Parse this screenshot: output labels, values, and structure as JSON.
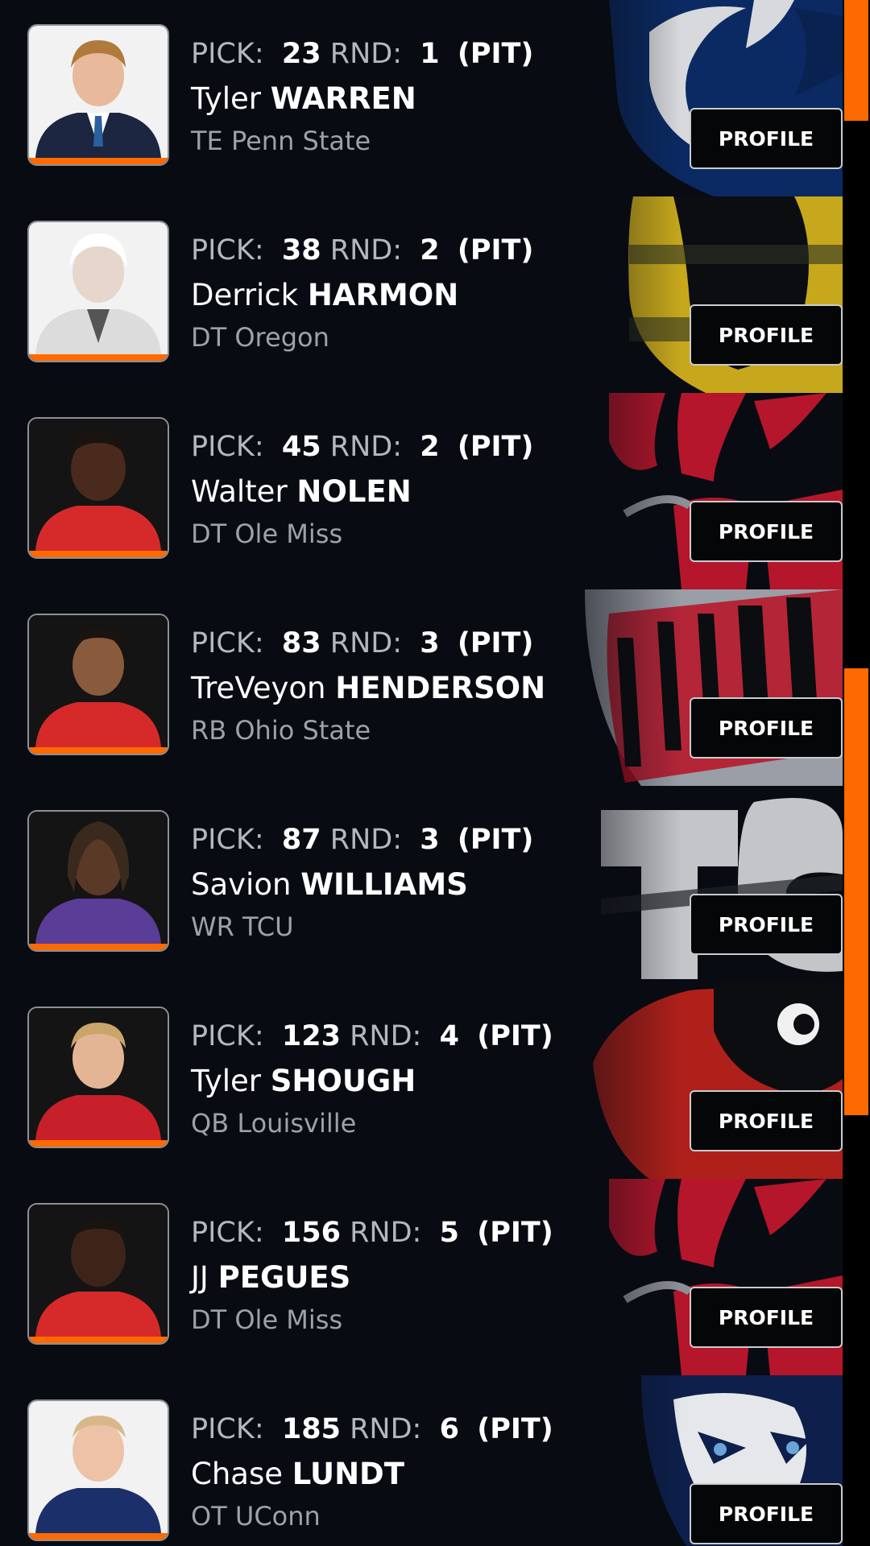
{
  "labels": {
    "pick": "PICK:",
    "round": "RND:",
    "profile": "PROFILE"
  },
  "colors": {
    "accent": "#ff6a00",
    "row_bg": "#080b12"
  },
  "picks": [
    {
      "pick": "23",
      "round": "1",
      "team": "(PIT)",
      "first": "Tyler",
      "last": "WARREN",
      "position_school": "TE Penn State",
      "logo": "penn-state-logo"
    },
    {
      "pick": "38",
      "round": "2",
      "team": "(PIT)",
      "first": "Derrick",
      "last": "HARMON",
      "position_school": "DT Oregon",
      "logo": "oregon-logo"
    },
    {
      "pick": "45",
      "round": "2",
      "team": "(PIT)",
      "first": "Walter",
      "last": "NOLEN",
      "position_school": "DT Ole Miss",
      "logo": "ole-miss-logo"
    },
    {
      "pick": "83",
      "round": "3",
      "team": "(PIT)",
      "first": "TreVeyon",
      "last": "HENDERSON",
      "position_school": "RB Ohio State",
      "logo": "ohio-state-logo"
    },
    {
      "pick": "87",
      "round": "3",
      "team": "(PIT)",
      "first": "Savion",
      "last": "WILLIAMS",
      "position_school": "WR TCU",
      "logo": "tcu-logo"
    },
    {
      "pick": "123",
      "round": "4",
      "team": "(PIT)",
      "first": "Tyler",
      "last": "SHOUGH",
      "position_school": "QB Louisville",
      "logo": "louisville-logo"
    },
    {
      "pick": "156",
      "round": "5",
      "team": "(PIT)",
      "first": "JJ",
      "last": "PEGUES",
      "position_school": "DT Ole Miss",
      "logo": "ole-miss-logo"
    },
    {
      "pick": "185",
      "round": "6",
      "team": "(PIT)",
      "first": "Chase",
      "last": "LUNDT",
      "position_school": "OT UConn",
      "logo": "uconn-logo"
    }
  ]
}
